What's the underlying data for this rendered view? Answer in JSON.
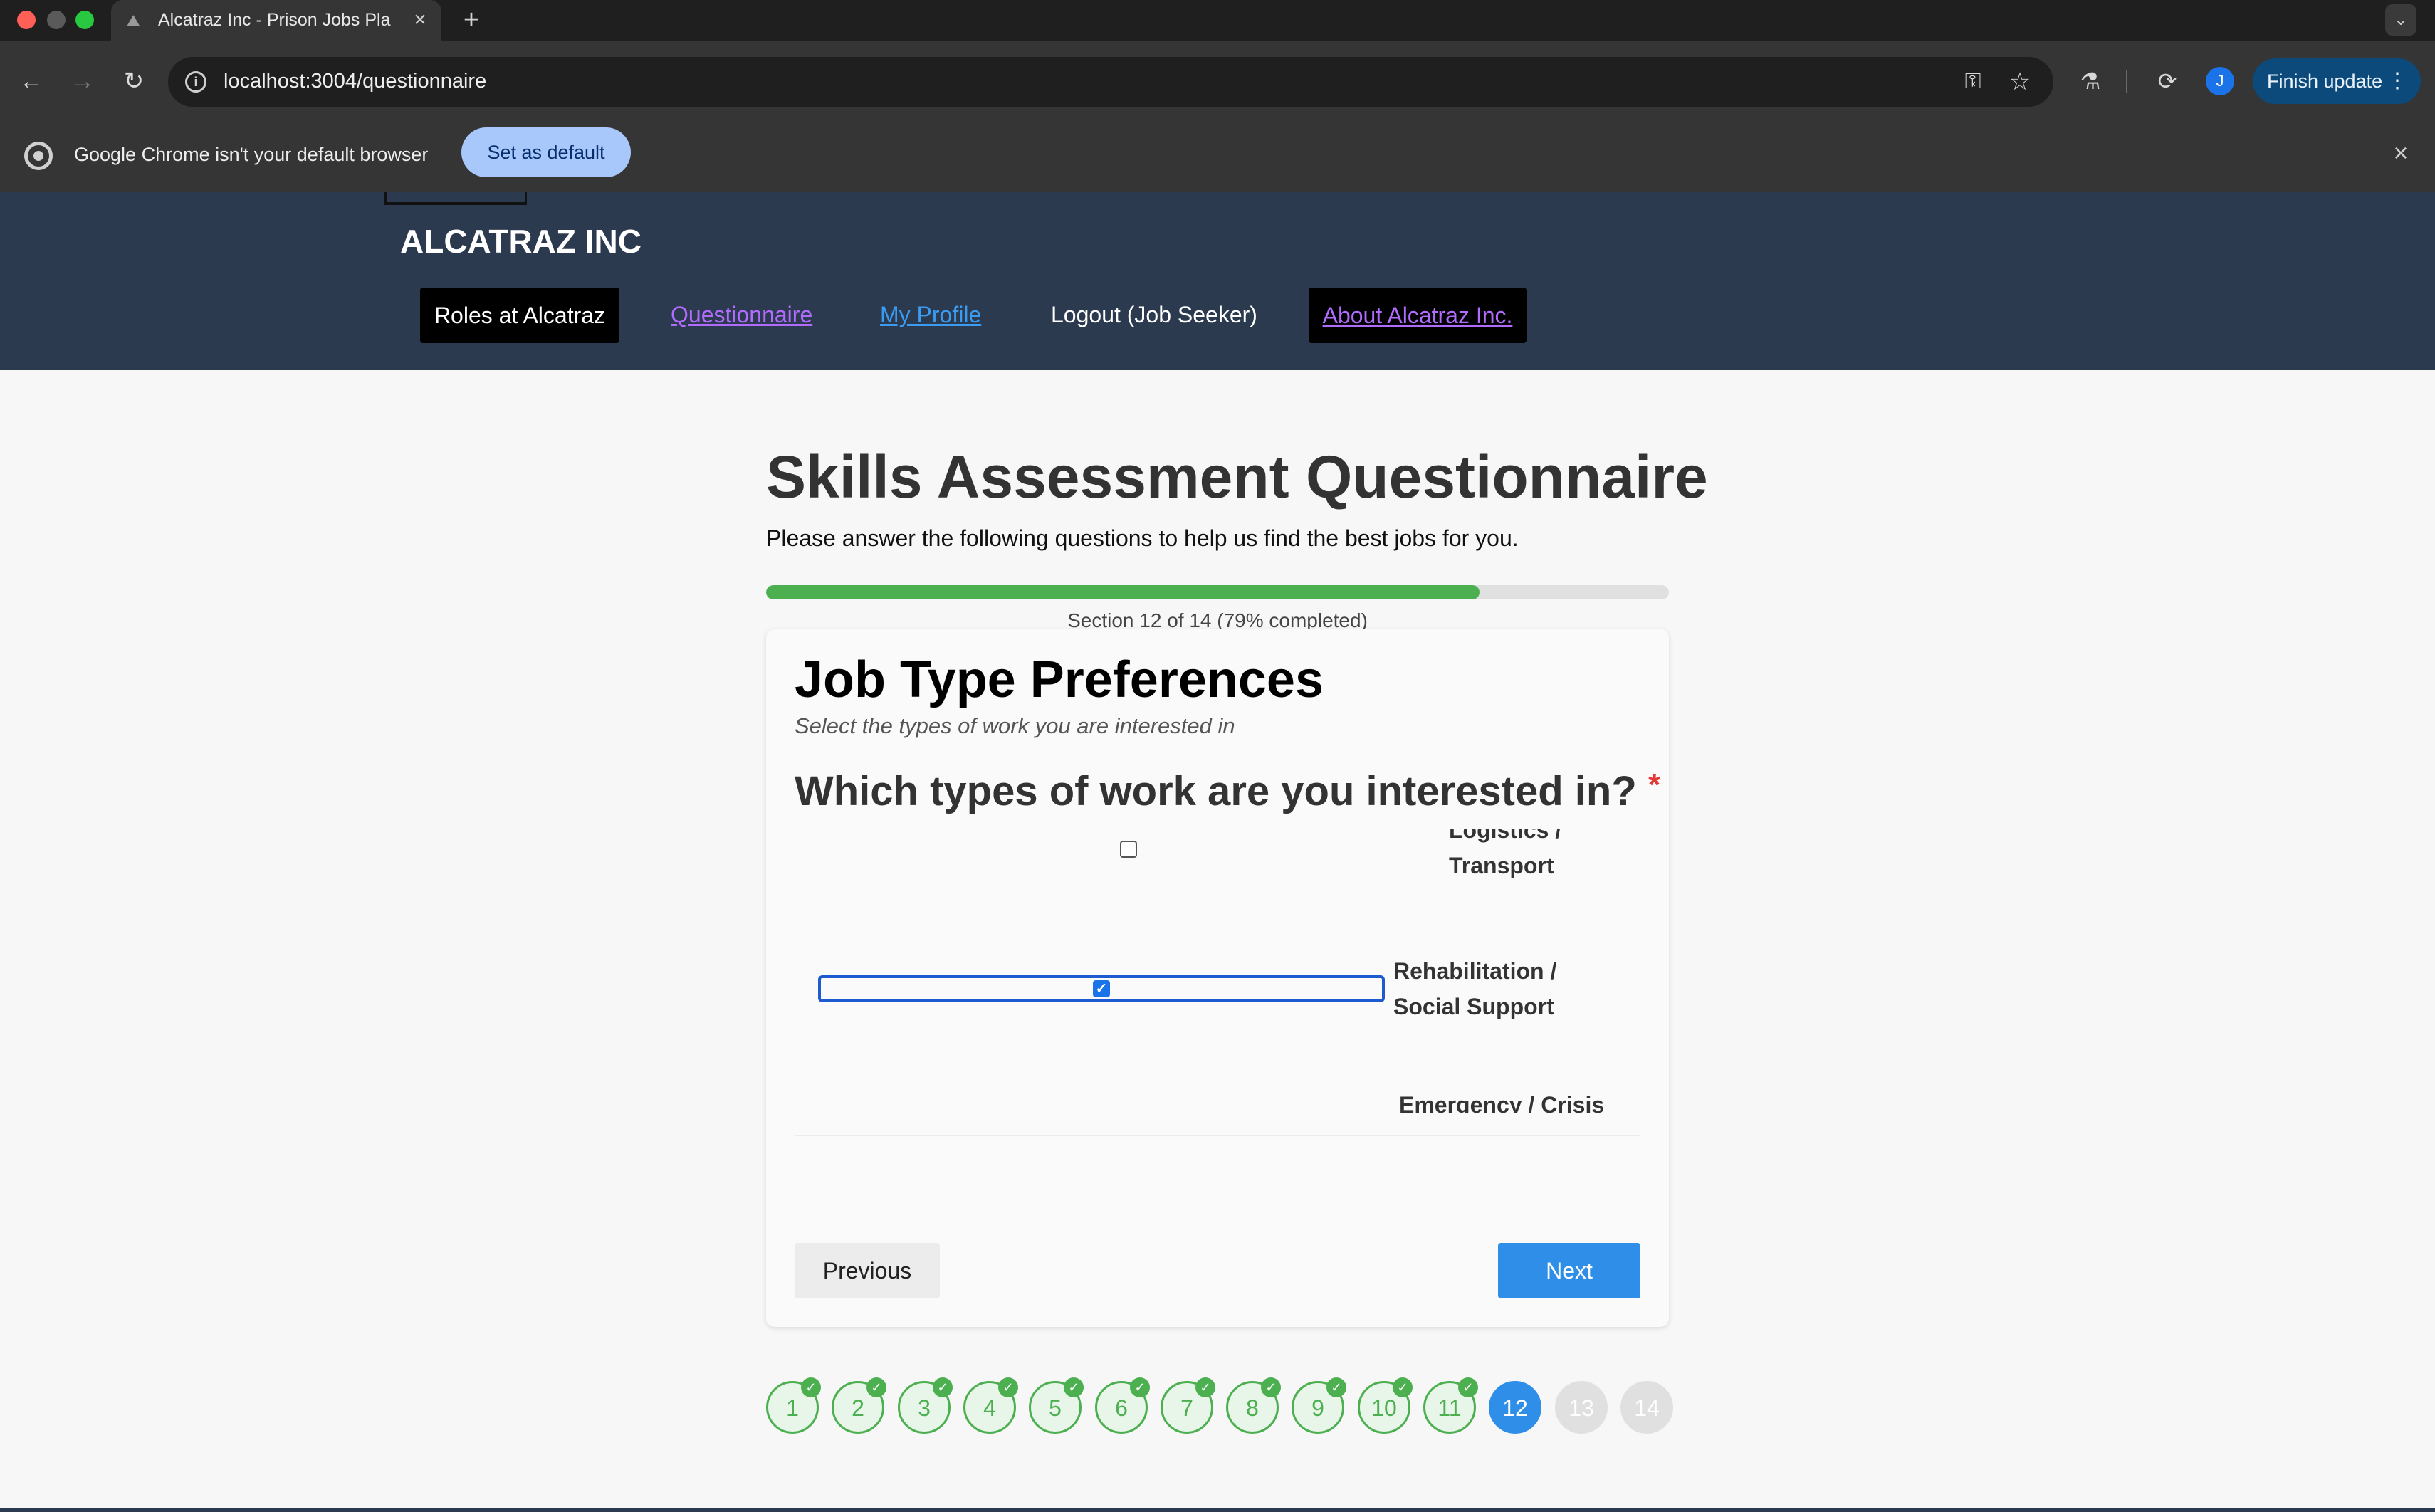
{
  "browser": {
    "tab_title": "Alcatraz Inc - Prison Jobs Pla",
    "url": "localhost:3004/questionnaire",
    "finish_update": "Finish update",
    "avatar_initial": "J",
    "infobar_text": "Google Chrome isn't your default browser",
    "set_default": "Set as default"
  },
  "site": {
    "brand": "ALCATRAZ INC",
    "nav": {
      "roles": "Roles at Alcatraz",
      "questionnaire": "Questionnaire",
      "profile": "My Profile",
      "logout": "Logout (Job Seeker)",
      "about": "About Alcatraz Inc."
    }
  },
  "page": {
    "title": "Skills Assessment Questionnaire",
    "subtitle": "Please answer the following questions to help us find the best jobs for you.",
    "progress_label": "Section 12 of 14 (79% completed)",
    "progress_percent": 79
  },
  "section": {
    "title": "Job Type Preferences",
    "subtitle": "Select the types of work you are interested in",
    "question": "Which types of work are you interested in?",
    "required_mark": "*",
    "options": [
      {
        "line1": "Logistics /",
        "line2": "Transport",
        "checked": false
      },
      {
        "line1": "Rehabilitation /",
        "line2": "Social Support",
        "checked": true
      },
      {
        "line1": "Emergency / Crisis",
        "line2": "",
        "checked": false
      }
    ]
  },
  "buttons": {
    "previous": "Previous",
    "next": "Next"
  },
  "steps": {
    "labels": [
      "1",
      "2",
      "3",
      "4",
      "5",
      "6",
      "7",
      "8",
      "9",
      "10",
      "11",
      "12",
      "13",
      "14"
    ],
    "completed_through": 11,
    "current": 12,
    "check_glyph": "✓"
  },
  "colors": {
    "header_bg": "#2b3a4f",
    "progress_fill": "#4caf50",
    "primary_button": "#2f8fe8",
    "nav_visited": "#b26bff",
    "nav_link": "#3a9bf0"
  }
}
